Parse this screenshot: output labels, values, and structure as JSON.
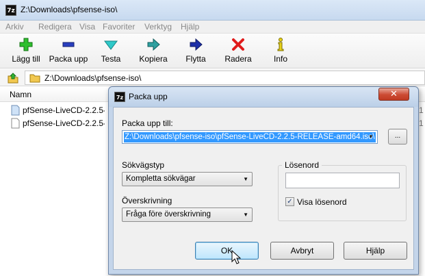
{
  "window": {
    "title": "Z:\\Downloads\\pfsense-iso\\",
    "app_icon": "7z"
  },
  "menu": [
    "Arkiv",
    "Redigera",
    "Visa",
    "Favoriter",
    "Verktyg",
    "Hjälp"
  ],
  "toolbar": {
    "add": "Lägg till",
    "extract": "Packa upp",
    "test": "Testa",
    "copy": "Kopiera",
    "move": "Flytta",
    "delete": "Radera",
    "info": "Info"
  },
  "address": {
    "path": "Z:\\Downloads\\pfsense-iso\\"
  },
  "filelist": {
    "column_name": "Namn",
    "files": [
      {
        "name": "pfSense-LiveCD-2.2.5-RELEASE-amd64.iso",
        "icon": "file-icon",
        "right_fragment": "1"
      },
      {
        "name": "pfSense-LiveCD-2.2.5-RELEASE-amd64.iso.gz",
        "icon": "file-icon",
        "right_fragment": "1"
      }
    ]
  },
  "dialog": {
    "title": "Packa upp",
    "close_label": "✕",
    "extract_to_label": "Packa upp till:",
    "extract_to_value": "Z:\\Downloads\\pfsense-iso\\pfSense-LiveCD-2.2.5-RELEASE-amd64.iso\\",
    "browse_label": "...",
    "path_mode_label": "Sökvägstyp",
    "path_mode_value": "Kompletta sökvägar",
    "overwrite_label": "Överskrivning",
    "overwrite_value": "Fråga före överskrivning",
    "password_label": "Lösenord",
    "password_value": "",
    "show_password_label": "Visa lösenord",
    "show_password_checked": true,
    "ok": "OK",
    "cancel": "Avbryt",
    "help": "Hjälp"
  },
  "colors": {
    "selection": "#3399ff",
    "close_button": "#cc4a33",
    "dialog_frame": "#c4d5ea"
  }
}
